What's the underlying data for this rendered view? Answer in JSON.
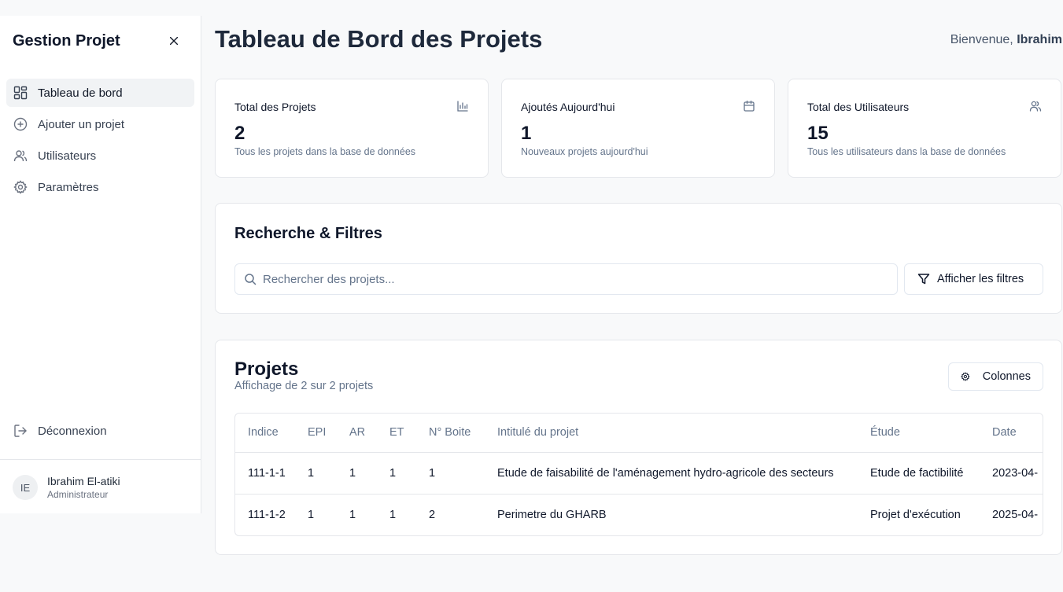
{
  "sidebar": {
    "title": "Gestion Projet",
    "items": [
      {
        "label": "Tableau de bord",
        "icon": "dashboard-icon"
      },
      {
        "label": "Ajouter un projet",
        "icon": "plus-circle-icon"
      },
      {
        "label": "Utilisateurs",
        "icon": "users-icon"
      },
      {
        "label": "Paramètres",
        "icon": "gear-icon"
      }
    ],
    "logout_label": "Déconnexion",
    "user": {
      "initials": "IE",
      "name": "Ibrahim El-atiki",
      "role": "Administrateur"
    }
  },
  "header": {
    "title": "Tableau de Bord des Projets",
    "welcome_prefix": "Bienvenue,",
    "welcome_name": "Ibrahim"
  },
  "stats": [
    {
      "label": "Total des Projets",
      "value": "2",
      "desc": "Tous les projets dans la base de données",
      "icon": "bar-chart-icon"
    },
    {
      "label": "Ajoutés Aujourd'hui",
      "value": "1",
      "desc": "Nouveaux projets aujourd'hui",
      "icon": "calendar-icon"
    },
    {
      "label": "Total des Utilisateurs",
      "value": "15",
      "desc": "Tous les utilisateurs dans la base de données",
      "icon": "users-icon"
    }
  ],
  "filters": {
    "title": "Recherche & Filtres",
    "search_placeholder": "Rechercher des projets...",
    "search_value": "",
    "show_filters_label": "Afficher les filtres"
  },
  "projects": {
    "title": "Projets",
    "subtitle": "Affichage de 2 sur 2 projets",
    "columns_button": "Colonnes",
    "headers": [
      "Indice",
      "EPI",
      "AR",
      "ET",
      "N° Boite",
      "Intitulé du projet",
      "Étude",
      "Date"
    ],
    "rows": [
      [
        "111-1-1",
        "1",
        "1",
        "1",
        "1",
        "Etude de faisabilité de l'aménagement hydro-agricole des secteurs",
        "Etude de factibilité",
        "2023-04-"
      ],
      [
        "111-1-2",
        "1",
        "1",
        "1",
        "2",
        "Perimetre du GHARB",
        "Projet d'exécution",
        "2025-04-"
      ]
    ]
  }
}
